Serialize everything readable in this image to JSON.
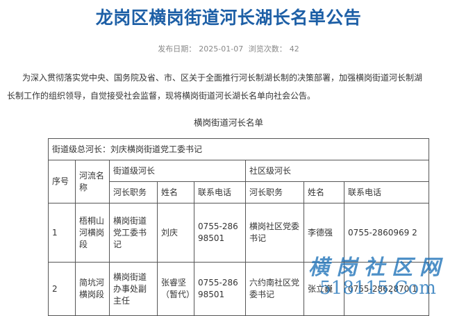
{
  "header": {
    "title": "龙岗区横岗街道河长湖长名单公告",
    "publish_label": "发布日期：",
    "publish_date": "2025-01-07",
    "views_label": "浏览次数：",
    "views": "42"
  },
  "body": {
    "paragraph_line1": "为深入贯彻落实党中央、国务院及省、市、区关于全面推行河长制湖长制的决策部署，加强横岗街道河长制湖",
    "paragraph_line2": "长制工作的组织领导，自觉接受社会监督，现将横岗街道河长湖长名单向社会公告。",
    "table_caption": "横岗街道河长名单"
  },
  "roster": {
    "chief_row": "街道级总河长：刘庆横岗街道党工委书记",
    "headers": {
      "seq": "序号",
      "river": "河流名称",
      "street_group": "街道级河长",
      "community_group": "社区级河长",
      "role": "河长职务",
      "name": "姓名",
      "phone": "联系电话"
    },
    "rows": [
      {
        "seq": "1",
        "river": "梧桐山河横岗段",
        "street_role": "横岗街道党工委书记",
        "street_name": "刘庆",
        "street_phone": "0755-28698501",
        "comm_role": "横岗社区党委书记",
        "comm_name": "李德强",
        "comm_phone": "0755-2860969 2"
      },
      {
        "seq": "2",
        "river": "简坑河横岗段",
        "street_role": "横岗街道办事处副主任",
        "street_name": "张睿坚（暂代）",
        "street_phone": "0755-28698501",
        "comm_role": "六约南社区党委书记",
        "comm_name": "张立巍",
        "comm_phone": "0755-2862870 1"
      }
    ]
  },
  "watermark": {
    "cn": "横岗社区网",
    "url": "518115.Com"
  },
  "colors": {
    "title": "#1d5fa6",
    "watermark": "#1d72b8",
    "border": "#555555"
  }
}
